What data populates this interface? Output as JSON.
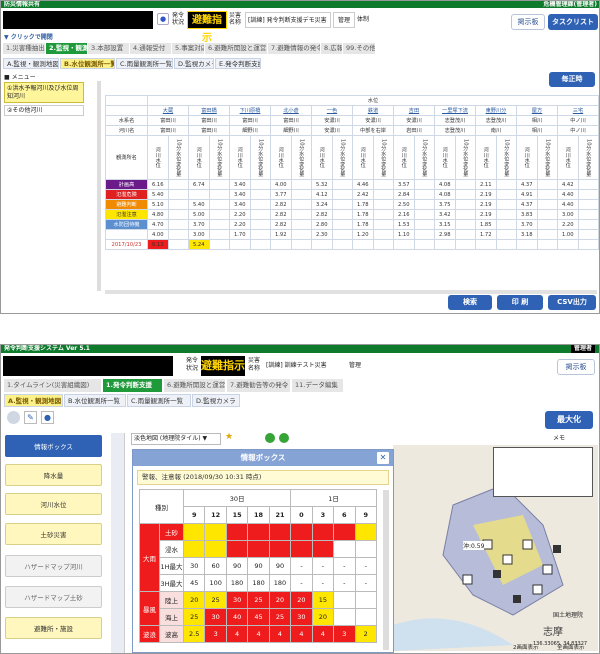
{
  "top": {
    "app_title": "防災情報共有",
    "right_user": "危機管理課(管理者)",
    "status_label": "発令状況",
    "order_text": "避難指示",
    "disaster_label": "災害名称",
    "disaster_name": "[訓練] 発令判断支援デモ災害",
    "mgr": "管理",
    "mode": "体制",
    "btn_board": "掲示板",
    "btn_tasklist": "タスクリスト",
    "quick_label": "クリックで開閉",
    "main_tabs": [
      "1.災害種抽出",
      "2.監視・観測",
      "3.本部設置",
      "4.通報受付",
      "5.事案対応",
      "6.避難所開設と運営",
      "7.避難情報の発令",
      "8.広報",
      "99.その他"
    ],
    "sub_tabs": [
      "A.監視・観測地図",
      "B.水位観測所一覧",
      "C.雨量観測所一覧",
      "D.監視カメラ",
      "E.発令判断支援"
    ],
    "menu_title": "メニュー",
    "menu_items": [
      "①洪水予報河川及び水位周知河川",
      "②その他河川"
    ],
    "btn_refresh": "毎正時",
    "table_title": "水位",
    "stations": [
      "大蔵",
      "富田橋",
      "下川原橋",
      "北小倉",
      "一色",
      "鉄道",
      "吉田",
      "一里塚下流",
      "東野川分",
      "屋方",
      "三宅"
    ],
    "row_label_sys": "水系名",
    "row_label_river": "河川名",
    "row_label_station": "観測所名",
    "sys_names": [
      "富田川",
      "富田川",
      "富田川",
      "富田川",
      "安濃川",
      "安濃川",
      "安濃川",
      "志登茂川",
      "志登茂川",
      "相川",
      "中ノ川"
    ],
    "river_names": [
      "富田川",
      "富田川",
      "細野川",
      "細野川",
      "安濃川",
      "中部を右岸",
      "岩田川",
      "志登茂川",
      "南川",
      "相川",
      "中ノ川"
    ],
    "col_a": "河川水位",
    "col_b": "10分水位変化量",
    "levels": [
      "計画高",
      "氾濫危険",
      "避難判断",
      "氾濫注意",
      "水防団待機"
    ],
    "level_colors": [
      "#6b1a8a",
      "#e02020",
      "#f08a00",
      "#ffe600",
      "#5b8fd0"
    ],
    "level_values": [
      [
        "6.16",
        "6.74",
        "3.40",
        "4.00",
        "5.32",
        "4.46",
        "3.57",
        "4.08",
        "2.11",
        "4.37",
        "4.42"
      ],
      [
        "5.40",
        "",
        "3.40",
        "3.77",
        "4.12",
        "2.42",
        "2.84",
        "4.08",
        "2.19",
        "4.91",
        "4.40"
      ],
      [
        "5.10",
        "5.40",
        "3.40",
        "2.82",
        "3.24",
        "1.78",
        "2.50",
        "3.75",
        "2.19",
        "4.37",
        "4.40"
      ],
      [
        "4.80",
        "5.00",
        "2.20",
        "2.82",
        "2.82",
        "1.78",
        "2.16",
        "3.42",
        "2.19",
        "3.83",
        "3.00"
      ],
      [
        "4.70",
        "3.70",
        "2.20",
        "2.82",
        "2.80",
        "1.78",
        "1.53",
        "3.15",
        "1.85",
        "3.70",
        "2.20"
      ],
      [
        "4.00",
        "3.00",
        "1.70",
        "1.92",
        "2.30",
        "1.20",
        "1.10",
        "2.98",
        "1.72",
        "3.18",
        "1.00"
      ]
    ],
    "date_cell": "2017/10/23",
    "val_red": "6.13",
    "val_yel": "5.24",
    "btn_search": "検索",
    "btn_print": "印 刷",
    "btn_csv": "CSV出力"
  },
  "bottom": {
    "app_title": "発令判断支援システム Ver 5.1",
    "right_user": "管理者",
    "status_label": "発令状況",
    "order_text": "避難指示",
    "disaster_label": "災害名称",
    "disaster_name": "[訓練] 訓練テスト災害",
    "mgr": "管理",
    "btn_board": "掲示板",
    "main_tabs": [
      "1.タイムライン(災害組織図)",
      "1.発令判断支援",
      "6.避難所開設と運営",
      "7.避難勧告等の発令",
      "11.データ編集"
    ],
    "sub_tabs": [
      "A.監視・観測地図",
      "B.水位観測所一覧",
      "C.雨量観測所一覧",
      "D.監視カメラ"
    ],
    "btn_max": "最大化",
    "side_buttons": [
      "情報ボックス",
      "降水量",
      "河川水位",
      "土砂災害",
      "ハザードマップ河川",
      "ハザードマップ土砂",
      "避難所・施設"
    ],
    "map_layer": "淡色地図 (地理院タイル)",
    "memo": "メモ",
    "info_title": "情報ボックス",
    "info_notice": "警報、注意報 (2018/09/30 10:31 時点)",
    "col_kind": "種別",
    "day1": "30日",
    "day2": "1日",
    "hours": [
      "9",
      "12",
      "15",
      "18",
      "21",
      "0",
      "3",
      "6",
      "9"
    ],
    "cat_rain": "大雨",
    "cat_wind": "暴風",
    "cat_wave": "波浪",
    "row_dosya": "土砂",
    "row_shinsui": "浸水",
    "row_1h": "1H最大",
    "row_3h": "3H最大",
    "row_land": "陸上",
    "row_sea": "海上",
    "row_wave": "波高",
    "vals_1h": [
      "30",
      "60",
      "90",
      "90",
      "90",
      "-",
      "-",
      "-",
      "-"
    ],
    "vals_3h": [
      "45",
      "100",
      "180",
      "180",
      "180",
      "-",
      "-",
      "-",
      "-"
    ],
    "vals_land": [
      "20",
      "25",
      "30",
      "25",
      "20",
      "20",
      "15",
      "",
      ""
    ],
    "vals_sea": [
      "25",
      "30",
      "40",
      "45",
      "25",
      "30",
      "20",
      "",
      ""
    ],
    "vals_wave": [
      "2.5",
      "3",
      "4",
      "4",
      "4",
      "4",
      "4",
      "3",
      "2"
    ],
    "map_label_1": "志摩",
    "map_label_2": "国土地理院",
    "map_label_3": "沖:0.59",
    "map_coord": "136.33065, 34.83327",
    "map_btn_1": "2画面表示",
    "map_btn_2": "全画面表示"
  }
}
